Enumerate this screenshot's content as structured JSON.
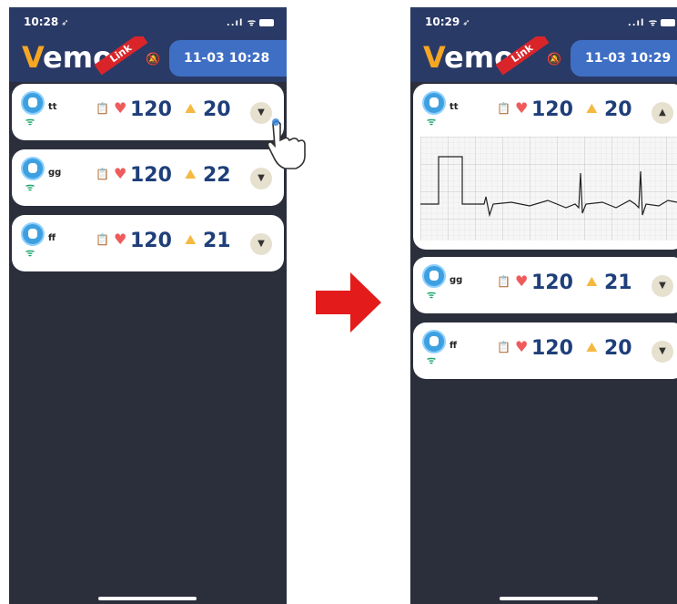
{
  "left": {
    "status": {
      "time": "10:28",
      "signal": "..ıl",
      "wifi": "ᯤ"
    },
    "logo": {
      "v": "V",
      "text": "emo",
      "ribbon": "Link"
    },
    "datetime": "11-03 10:28",
    "patients": [
      {
        "name": "tt",
        "hr": "120",
        "rr": "20",
        "expanded": false
      },
      {
        "name": "gg",
        "hr": "120",
        "rr": "22",
        "expanded": false
      },
      {
        "name": "ff",
        "hr": "120",
        "rr": "21",
        "expanded": false
      }
    ]
  },
  "right": {
    "status": {
      "time": "10:29",
      "signal": "..ıl",
      "wifi": "ᯤ"
    },
    "logo": {
      "v": "V",
      "text": "emo",
      "ribbon": "Link"
    },
    "datetime": "11-03 10:29",
    "patients": [
      {
        "name": "tt",
        "hr": "120",
        "rr": "20",
        "expanded": true
      },
      {
        "name": "gg",
        "hr": "120",
        "rr": "21",
        "expanded": false
      },
      {
        "name": "ff",
        "hr": "120",
        "rr": "20",
        "expanded": false
      }
    ]
  },
  "icons": {
    "expand": "chevron-down-icon",
    "collapse": "chevron-up-icon",
    "heart": "heart-icon",
    "lung": "lung-icon",
    "bell": "bell-off-icon",
    "clipboard": "clipboard-heart-icon",
    "transition": "right-arrow-icon",
    "tap": "hand-pointer-icon"
  },
  "colors": {
    "bg": "#2b2e3b",
    "header": "#2a3a66",
    "datepill": "#3f6fc4",
    "heart": "#ef5b5b",
    "lung": "#f5b942",
    "ribbon": "#d9252a",
    "arrow": "#e31b1b",
    "value": "#1f3f7a",
    "wifi": "#1ea66b"
  }
}
